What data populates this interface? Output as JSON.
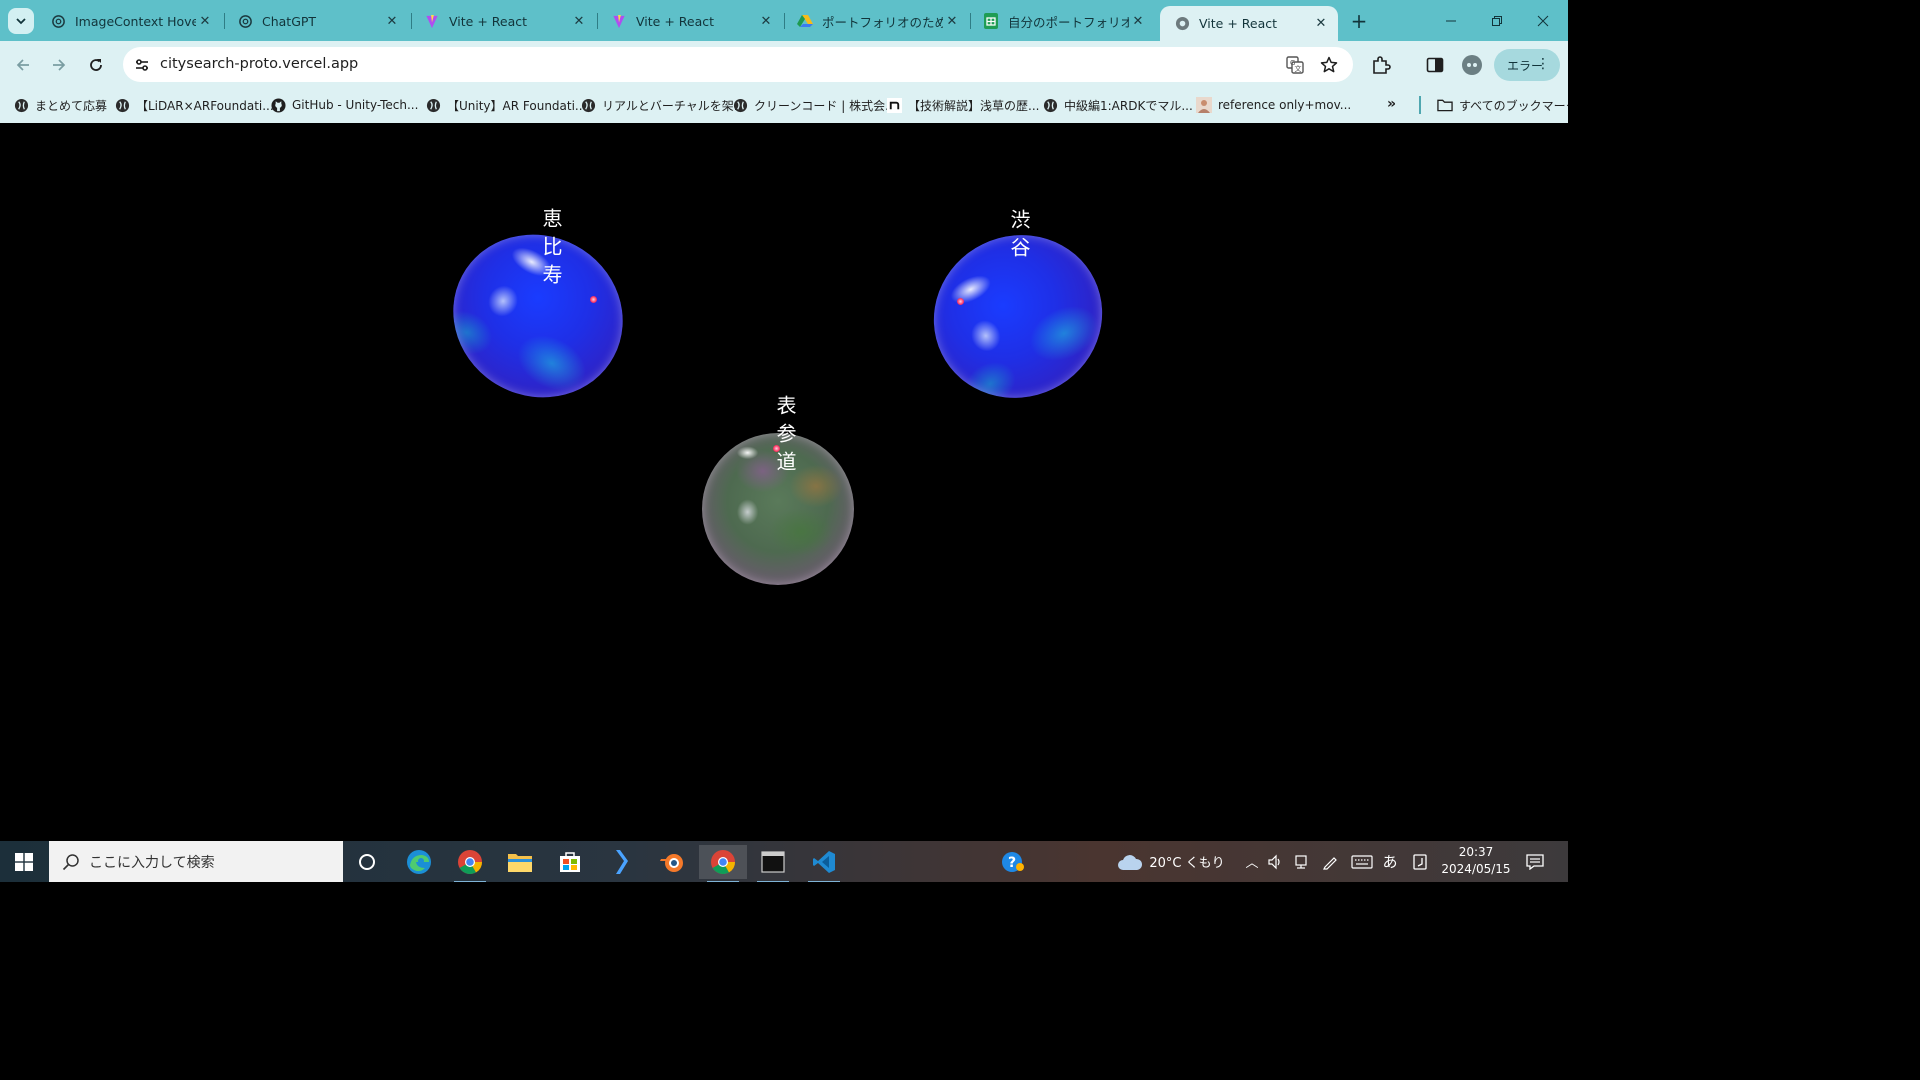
{
  "browser": {
    "tabs": [
      {
        "title": "ImageContext Hover",
        "favicon": "openai-icon"
      },
      {
        "title": "ChatGPT",
        "favicon": "openai-icon"
      },
      {
        "title": "Vite + React",
        "favicon": "vite-icon"
      },
      {
        "title": "Vite + React",
        "favicon": "vite-icon"
      },
      {
        "title": "ポートフォリオのために -",
        "favicon": "google-drive-icon"
      },
      {
        "title": "自分のポートフォリオ等",
        "favicon": "google-sheets-icon"
      },
      {
        "title": "Vite + React",
        "favicon": "globe-icon",
        "active": true
      }
    ],
    "url": "citysearch-proto.vercel.app",
    "profile_label": "エラー",
    "bookmarks": [
      {
        "label": "まとめて応募",
        "icon": "globe-icon"
      },
      {
        "label": "【LiDAR×ARFoundati...",
        "icon": "globe-icon"
      },
      {
        "label": "GitHub - Unity-Tech...",
        "icon": "github-icon"
      },
      {
        "label": "【Unity】AR Foundati...",
        "icon": "globe-icon"
      },
      {
        "label": "リアルとバーチャルを架...",
        "icon": "globe-icon"
      },
      {
        "label": "クリーンコード | 株式会...",
        "icon": "globe-icon"
      },
      {
        "label": "【技術解説】浅草の歴...",
        "icon": "note-icon"
      },
      {
        "label": "中級編1:ARDKでマル...",
        "icon": "globe-icon"
      },
      {
        "label": "reference only+mov...",
        "icon": "image-thumb-icon"
      }
    ],
    "all_bookmarks_label": "すべてのブックマーク"
  },
  "page": {
    "spheres": [
      {
        "label": "恵比寿",
        "style": "blue"
      },
      {
        "label": "渋谷",
        "style": "blue"
      },
      {
        "label": "表参道",
        "style": "green"
      }
    ]
  },
  "taskbar": {
    "search_placeholder": "ここに入力して検索",
    "weather": "20°C くもり",
    "ime": "あ",
    "time": "20:37",
    "date": "2024/05/15"
  }
}
